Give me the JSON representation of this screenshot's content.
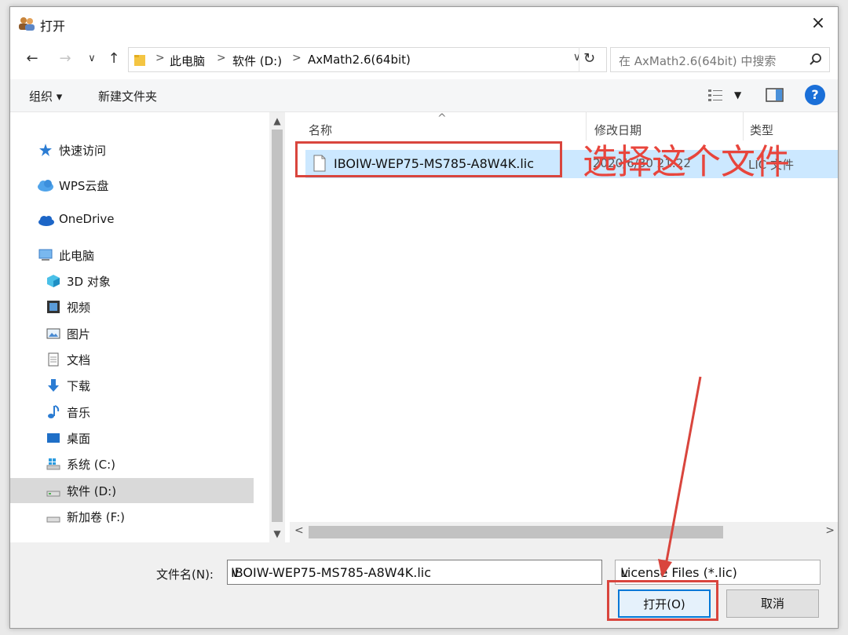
{
  "window": {
    "title": "打开",
    "close_label": "×"
  },
  "address": {
    "crumbs": [
      "此电脑",
      "软件 (D:)",
      "AxMath2.6(64bit)"
    ],
    "separator": ">",
    "search_placeholder": "在 AxMath2.6(64bit) 中搜索"
  },
  "toolbar": {
    "organize": "组织 ▾",
    "new_folder": "新建文件夹",
    "help": "?"
  },
  "nav": {
    "items": [
      {
        "label": "快速访问",
        "icon": "star-icon"
      },
      {
        "label": "WPS云盘",
        "icon": "cloud-icon"
      },
      {
        "label": "OneDrive",
        "icon": "onedrive-icon"
      },
      {
        "label": "此电脑",
        "icon": "computer-icon"
      },
      {
        "label": "3D 对象",
        "icon": "cube-icon"
      },
      {
        "label": "视频",
        "icon": "video-icon"
      },
      {
        "label": "图片",
        "icon": "picture-icon"
      },
      {
        "label": "文档",
        "icon": "document-icon"
      },
      {
        "label": "下载",
        "icon": "download-icon"
      },
      {
        "label": "音乐",
        "icon": "music-icon"
      },
      {
        "label": "桌面",
        "icon": "desktop-icon"
      },
      {
        "label": "系统 (C:)",
        "icon": "windows-drive-icon"
      },
      {
        "label": "软件 (D:)",
        "icon": "drive-icon"
      },
      {
        "label": "新加卷 (F:)",
        "icon": "drive-icon"
      }
    ],
    "selected_index": 12
  },
  "columns": {
    "name": "名称",
    "date": "修改日期",
    "type": "类型"
  },
  "files": [
    {
      "name": "IBOIW-WEP75-MS785-A8W4K.lic",
      "date": "2020/6/30 21:22",
      "type": "LIC 文件"
    }
  ],
  "bottom": {
    "filename_label": "文件名(N):",
    "filename_value": "IBOIW-WEP75-MS785-A8W4K.lic",
    "filetype_value": "License Files (*.lic)",
    "open_button": "打开(O)",
    "cancel_button": "取消"
  },
  "annotation": {
    "text": "选择这个文件",
    "color": "#e8453c"
  },
  "colors": {
    "selection": "#cce8ff",
    "accent": "#0078d7",
    "highlight": "#d9453d"
  }
}
